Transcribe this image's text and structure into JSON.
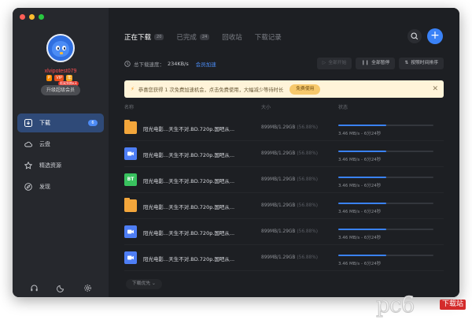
{
  "sidebar": {
    "username": "xlvipotest079",
    "vip_badges": [
      "P",
      "VIP",
      "年"
    ],
    "vip_tag": "距离到期8天",
    "upgrade_label": "升级超级会员",
    "nav": [
      {
        "label": "下载",
        "icon": "download-icon",
        "badge": "6",
        "active": true
      },
      {
        "label": "云盘",
        "icon": "cloud-icon"
      },
      {
        "label": "精选资源",
        "icon": "star-icon"
      },
      {
        "label": "发现",
        "icon": "compass-icon"
      }
    ],
    "bottom_icons": [
      "headset-icon",
      "moon-icon",
      "settings-icon"
    ]
  },
  "tabs": [
    {
      "label": "正在下载",
      "count": "20",
      "active": true
    },
    {
      "label": "已完成",
      "count": "24"
    },
    {
      "label": "回收站"
    },
    {
      "label": "下载记录"
    }
  ],
  "speed": {
    "label": "总下载速度：",
    "value": "234KB/s",
    "link": "会员加速"
  },
  "toolbar": {
    "start_all": "全部开始",
    "pause_all": "全部暂停",
    "sort": "按照时间排序"
  },
  "banner": {
    "text": "恭喜您获得 1 次免费加速机会，点击免费使用，大幅减少等待时长",
    "button": "免费使用"
  },
  "columns": {
    "name": "名称",
    "size": "大小",
    "status": "状态"
  },
  "files": [
    {
      "icon": "folder-icon",
      "name": "阳光电影...天生不对.BD.720p.国吧从...",
      "size": "899MB/1.29GB",
      "percent": "(56.88%)",
      "progress": 0.5,
      "status": "3.46 MB/s - 6分24秒"
    },
    {
      "icon": "video-icon",
      "name": "阳光电影...天生不对.BD.720p.国吧从...",
      "size": "899MB/1.29GB",
      "percent": "(56.88%)",
      "progress": 0.5,
      "status": "3.46 MB/s - 6分24秒"
    },
    {
      "icon": "bt-icon",
      "icon_text": "BT",
      "name": "阳光电影...天生不对.BD.720p.国吧从...",
      "size": "899MB/1.29GB",
      "percent": "(56.88%)",
      "progress": 0.5,
      "status": "3.46 MB/s - 6分24秒"
    },
    {
      "icon": "folder-icon",
      "name": "阳光电影...天生不对.BD.720p.国吧从...",
      "size": "899MB/1.29GB",
      "percent": "(56.88%)",
      "progress": 0.5,
      "status": "3.46 MB/s - 6分24秒"
    },
    {
      "icon": "video-icon",
      "name": "阳光电影...天生不对.BD.720p.国吧从...",
      "size": "899MB/1.29GB",
      "percent": "(56.88%)",
      "progress": 0.5,
      "status": "3.46 MB/s - 6分24秒"
    },
    {
      "icon": "video-icon",
      "name": "阳光电影...天生不对.BD.720p.国吧从...",
      "size": "899MB/1.29GB",
      "percent": "(56.88%)",
      "progress": 0.5,
      "status": "3.46 MB/s - 6分24秒"
    }
  ],
  "footer": {
    "priority_label": "下载优先"
  },
  "watermark": {
    "text": "pc6",
    "tag": "下载站"
  },
  "colors": {
    "accent": "#3a82f7",
    "banner_bg": "#fff4d9",
    "sidebar_bg": "#26282d",
    "main_bg": "#1d1f23"
  }
}
